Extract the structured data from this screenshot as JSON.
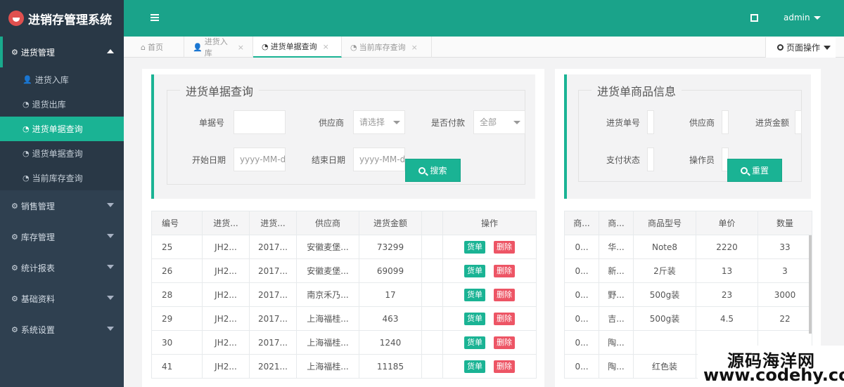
{
  "app": {
    "title": "进销存管理系统",
    "user": "admin"
  },
  "sidebar": {
    "groups": [
      {
        "label": "进货管理",
        "items": [
          "进货入库",
          "退货出库",
          "进货单据查询",
          "退货单据查询",
          "当前库存查询"
        ],
        "active_item": "进货单据查询"
      },
      {
        "label": "销售管理"
      },
      {
        "label": "库存管理"
      },
      {
        "label": "统计报表"
      },
      {
        "label": "基础资料"
      },
      {
        "label": "系统设置"
      }
    ]
  },
  "tabs": [
    {
      "label": "首页",
      "closable": false
    },
    {
      "label": "进货入库",
      "closable": true
    },
    {
      "label": "进货单据查询",
      "closable": true,
      "active": true
    },
    {
      "label": "当前库存查询",
      "closable": true
    }
  ],
  "page_ops": "页面操作",
  "query": {
    "title": "进货单据查询",
    "order_no_label": "单据号",
    "order_no_value": "",
    "supplier_label": "供应商",
    "supplier_placeholder": "请选择",
    "paid_label": "是否付款",
    "paid_value": "全部",
    "start_label": "开始日期",
    "start_placeholder": "yyyy-MM-dd",
    "end_label": "结束日期",
    "end_placeholder": "yyyy-MM-dd",
    "search_button": "搜索"
  },
  "info": {
    "title": "进货单商品信息",
    "order_no_label": "进货单号",
    "supplier_label": "供应商",
    "amount_label": "进货金额",
    "pay_status_label": "支付状态",
    "operator_label": "操作员",
    "reset_button": "重置"
  },
  "orders": {
    "columns": [
      "编号",
      "进货...",
      "进货...",
      "供应商",
      "进货金额",
      "操作"
    ],
    "actions": {
      "view": "货单",
      "delete": "删除"
    },
    "rows": [
      [
        "25",
        "JH2...",
        "2017...",
        "安徽麦堡...",
        "73299"
      ],
      [
        "26",
        "JH2...",
        "2017...",
        "安徽麦堡...",
        "69099"
      ],
      [
        "28",
        "JH2...",
        "2017...",
        "南京禾乃...",
        "17"
      ],
      [
        "29",
        "JH2...",
        "2017...",
        "上海福桂...",
        "463"
      ],
      [
        "30",
        "JH2...",
        "2017...",
        "上海福桂...",
        "1240"
      ],
      [
        "41",
        "JH2...",
        "2021...",
        "上海福桂...",
        "11185"
      ]
    ]
  },
  "goods": {
    "columns": [
      "商...",
      "商...",
      "商品型号",
      "单价",
      "数量"
    ],
    "rows": [
      [
        "0...",
        "华...",
        "Note8",
        "2220",
        "33"
      ],
      [
        "0...",
        "新...",
        "2斤装",
        "13",
        "3"
      ],
      [
        "0...",
        "野...",
        "500g装",
        "23",
        "3000"
      ],
      [
        "0...",
        "吉...",
        "500g装",
        "4.5",
        "22"
      ],
      [
        "0...",
        "陶...",
        "",
        "",
        ""
      ],
      [
        "0...",
        "陶...",
        "红色装",
        "",
        ""
      ]
    ]
  },
  "watermark": {
    "line1": "源码海洋网",
    "line2": "www.codehy.com"
  }
}
